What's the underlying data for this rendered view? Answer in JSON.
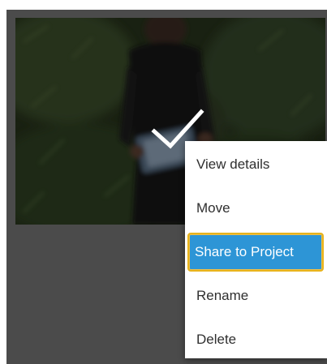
{
  "photo": {
    "overlay_icon": "check-icon"
  },
  "context_menu": {
    "items": [
      {
        "label": "View details"
      },
      {
        "label": "Move"
      },
      {
        "label": "Share to Project",
        "selected": true
      },
      {
        "label": "Rename"
      },
      {
        "label": "Delete"
      }
    ]
  },
  "colors": {
    "panel_bg": "#4b4b4b",
    "selected_bg": "#2d95d6",
    "focus_outline": "#e8b31c",
    "menu_text": "#2f2f2f"
  }
}
